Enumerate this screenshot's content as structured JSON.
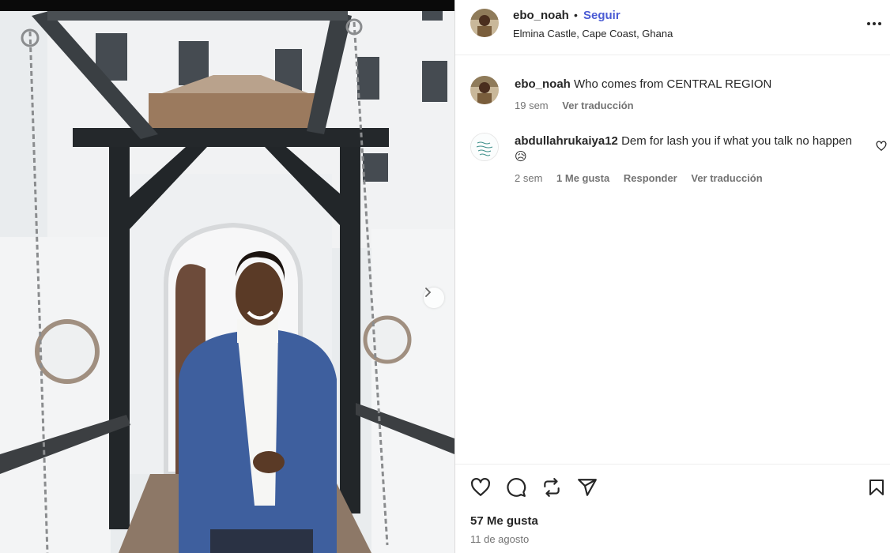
{
  "post": {
    "username": "ebo_noah",
    "follow_label": "Seguir",
    "separator": "•",
    "location": "Elmina Castle, Cape Coast, Ghana"
  },
  "comments": [
    {
      "username": "ebo_noah",
      "text": "Who comes from CENTRAL REGION",
      "time": "19 sem",
      "translate_label": "Ver traducción"
    },
    {
      "username": "abdullahrukaiya12",
      "text": "Dem for lash you if what you talk no happen",
      "emoji": "😥",
      "time": "2 sem",
      "likes_label": "1 Me gusta",
      "reply_label": "Responder",
      "translate_label": "Ver traducción"
    }
  ],
  "footer": {
    "likes": "57 Me gusta",
    "date": "11 de agosto"
  },
  "icons": {
    "header_more": "more-horizontal-icon",
    "like": "heart-icon",
    "comment": "comment-bubble-icon",
    "share": "repost-icon",
    "send": "send-icon",
    "save": "bookmark-icon",
    "next": "chevron-right-icon"
  },
  "colors": {
    "follow": "#4a5bd4",
    "muted": "#737373",
    "text": "#262626"
  }
}
